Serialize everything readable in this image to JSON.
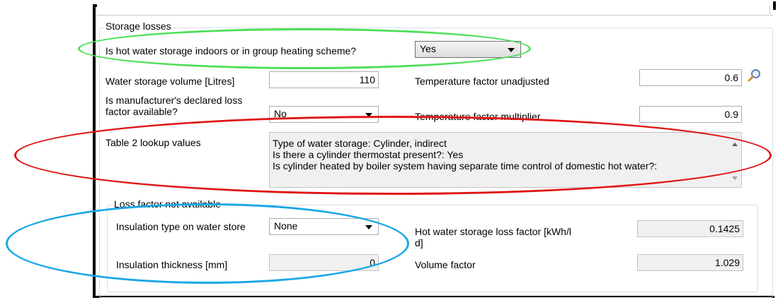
{
  "storage_losses": {
    "title": "Storage losses",
    "indoors_label": "Is hot water storage indoors or in group heating scheme?",
    "indoors_value": "Yes",
    "volume_label": "Water storage volume [Litres]",
    "volume_value": "110",
    "manufacturer_label": "Is manufacturer's declared loss factor available?",
    "manufacturer_value": "No",
    "temp_factor_unadj_label": "Temperature factor unadjusted",
    "temp_factor_unadj_value": "0.6",
    "temp_factor_mult_label": "Temperature factor multiplier",
    "temp_factor_mult_value": "0.9",
    "table2_label": "Table 2 lookup values",
    "table2_lines": [
      "Type of water storage: Cylinder, indirect",
      "Is there a cylinder thermostat present?: Yes",
      "Is cylinder heated by boiler system having separate time control of domestic hot water?:"
    ]
  },
  "loss_factor_not_available": {
    "title": "Loss factor not available",
    "insulation_type_label": "Insulation type on water store",
    "insulation_type_value": "None",
    "insulation_thickness_label": "Insulation thickness [mm]",
    "insulation_thickness_value": "0",
    "loss_factor_label": "Hot water storage loss factor [kWh/l d]",
    "loss_factor_value": "0.1425",
    "volume_factor_label": "Volume factor",
    "volume_factor_value": "1.029"
  },
  "icons": {
    "lookup": "magnifier-icon"
  },
  "highlight_colors": {
    "green": "#4cdf56",
    "red": "#e01515",
    "blue": "#1aa7e6"
  }
}
